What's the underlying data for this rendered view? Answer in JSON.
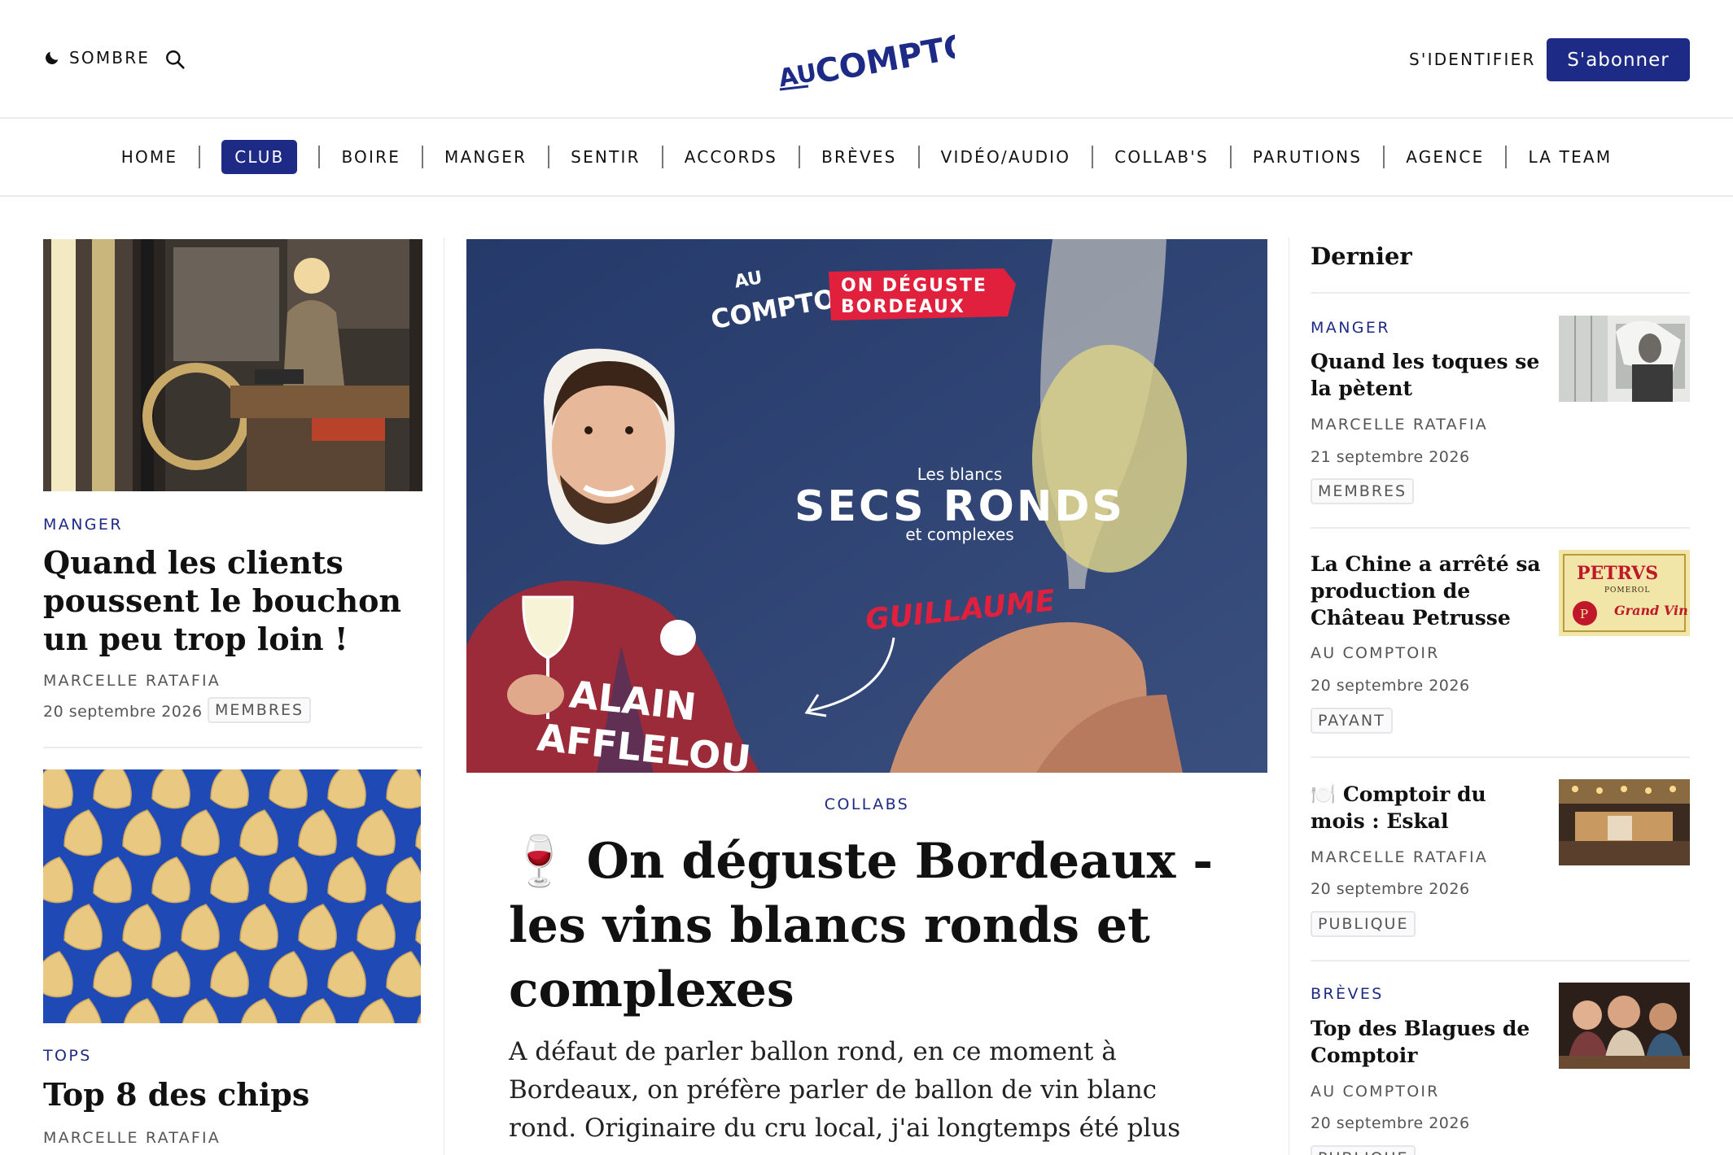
{
  "header": {
    "theme_label": "SOMBRE",
    "signin_label": "S'IDENTIFIER",
    "subscribe_label": "S'abonner",
    "logo_text_top": "AU",
    "logo_text_main": "COMPTOIR"
  },
  "nav": {
    "items": [
      "HOME",
      "CLUB",
      "BOIRE",
      "MANGER",
      "SENTIR",
      "ACCORDS",
      "BRÈVES",
      "VIDÉO/AUDIO",
      "COLLAB'S",
      "PARUTIONS",
      "AGENCE",
      "LA TEAM"
    ],
    "active": "CLUB"
  },
  "left": {
    "card1": {
      "kicker": "MANGER",
      "title": "Quand les clients poussent le bouchon un peu trop loin !",
      "author": "MARCELLE RATAFIA",
      "date": "20 septembre 2026",
      "badge": "MEMBRES"
    },
    "card2": {
      "kicker": "TOPS",
      "title": "Top 8 des chips",
      "author": "MARCELLE RATAFIA"
    }
  },
  "center": {
    "hero": {
      "logo_top": "AU",
      "logo_main": "COMPTOIR",
      "tag_line1": "ON DÉGUSTE",
      "tag_line2": "BORDEAUX",
      "small_top": "Les blancs",
      "big": "SECS RONDS",
      "small_bottom": "et complexes",
      "name": "GUILLAUME",
      "shirt_line1": "ALAIN",
      "shirt_line2": "AFFLELOU"
    },
    "kicker": "COLLABS",
    "headline_emoji": "🍷",
    "headline": "On déguste Bordeaux - les vins blancs ronds et complexes",
    "lead": "A défaut de parler ballon rond, en ce moment à Bordeaux, on préfère parler de ballon de vin blanc rond.  Originaire du cru local, j'ai longtemps été plus proche des blancs que des"
  },
  "sidebar": {
    "title": "Dernier",
    "items": [
      {
        "kicker": "MANGER",
        "title": "Quand les toques se la pètent",
        "author": "MARCELLE RATAFIA",
        "date": "21 septembre 2026",
        "badge": "MEMBRES"
      },
      {
        "kicker": "",
        "title": "La Chine a arrêté sa production de Château Petrusse",
        "author": "AU COMPTOIR",
        "date": "20 septembre 2026",
        "badge": "PAYANT",
        "thumb_text": "PETRVS",
        "thumb_sub": "POMEROL",
        "thumb_script": "Grand Vin"
      },
      {
        "kicker": "",
        "title_emoji": "🍽️",
        "title": "Comptoir du mois : Eskal",
        "author": "MARCELLE RATAFIA",
        "date": "20 septembre 2026",
        "badge": "PUBLIQUE"
      },
      {
        "kicker": "BRÈVES",
        "title": "Top des Blagues de Comptoir",
        "author": "AU COMPTOIR",
        "date": "20 septembre 2026",
        "badge": "PUBLIQUE"
      }
    ]
  },
  "colors": {
    "accent": "#1e2b86",
    "hero_bg": "#2f4370",
    "tag_red": "#e0203c"
  }
}
